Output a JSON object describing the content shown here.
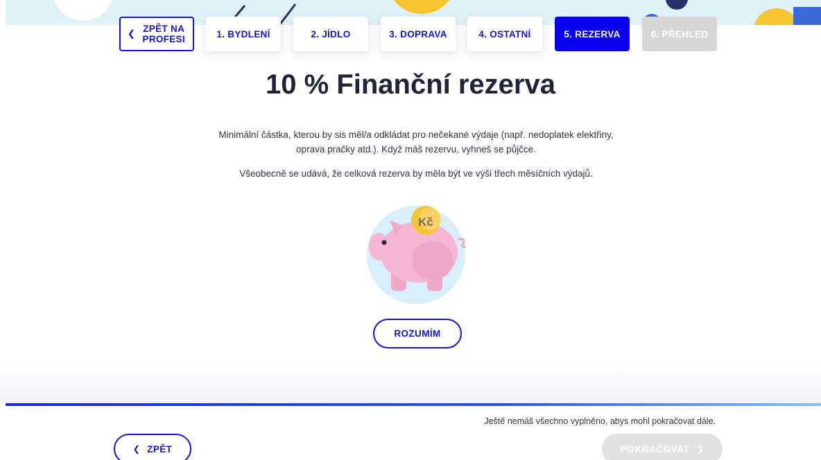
{
  "steps": {
    "back_label": "ZPĚT NA PROFESI",
    "items": [
      {
        "label": "1. BYDLENÍ"
      },
      {
        "label": "2. JÍDLO"
      },
      {
        "label": "3. DOPRAVA"
      },
      {
        "label": "4. OSTATNÍ"
      },
      {
        "label": "5. REZERVA"
      },
      {
        "label": "6. PŘEHLED"
      }
    ]
  },
  "main": {
    "title": "10 % Finanční rezerva",
    "description": "Minimální částka, kterou by sis měl/a odkládat pro nečekané výdaje (např. nedoplatek elektřiny, oprava pračky atd.). Když máš rezervu, vyhneš se půjčce.",
    "note": "Všeobecně se udává, že celková rezerva by měla být ve výši třech měsíčních výdajů.",
    "coin_label": "Kč",
    "understand_label": "ROZUMÍM"
  },
  "footer": {
    "notice": "Ještě nemáš všechno vyplněno, abys mohl pokračovat dále.",
    "back_label": "ZPĚT",
    "continue_label": "POKRAČOVAT"
  },
  "colors": {
    "accent": "#1212e0",
    "active_step": "#0a00f0",
    "disabled": "#d6d6d6",
    "piggy": "#f4b6d2",
    "coin": "#f7c531"
  },
  "icons": {
    "back_chevron": "chevron-left-icon",
    "next_chevron": "chevron-right-icon",
    "illustration": "piggy-bank-icon"
  }
}
